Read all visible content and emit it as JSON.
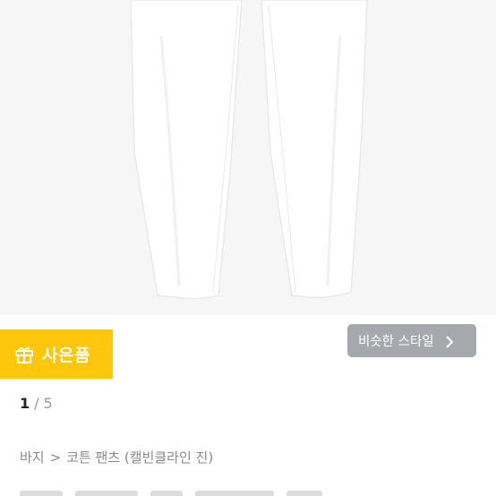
{
  "colors": {
    "image_background": "#f6f6f7",
    "gift_badge": "#ffc70c",
    "similar_button": "#a5a8ad",
    "pager_current": "#222222",
    "muted_text": "#8a8a8a"
  },
  "gift_badge": {
    "icon": "gift-icon",
    "label": "사은품"
  },
  "similar_style_button": {
    "label": "비슷한 스타일",
    "icon": "chevron-right-icon"
  },
  "pager": {
    "current": "1",
    "separator": "/",
    "total": "5"
  },
  "breadcrumb": {
    "category": "바지",
    "separator": ">",
    "subcategory": "코튼 팬츠 (캘빈클라인 진)"
  }
}
